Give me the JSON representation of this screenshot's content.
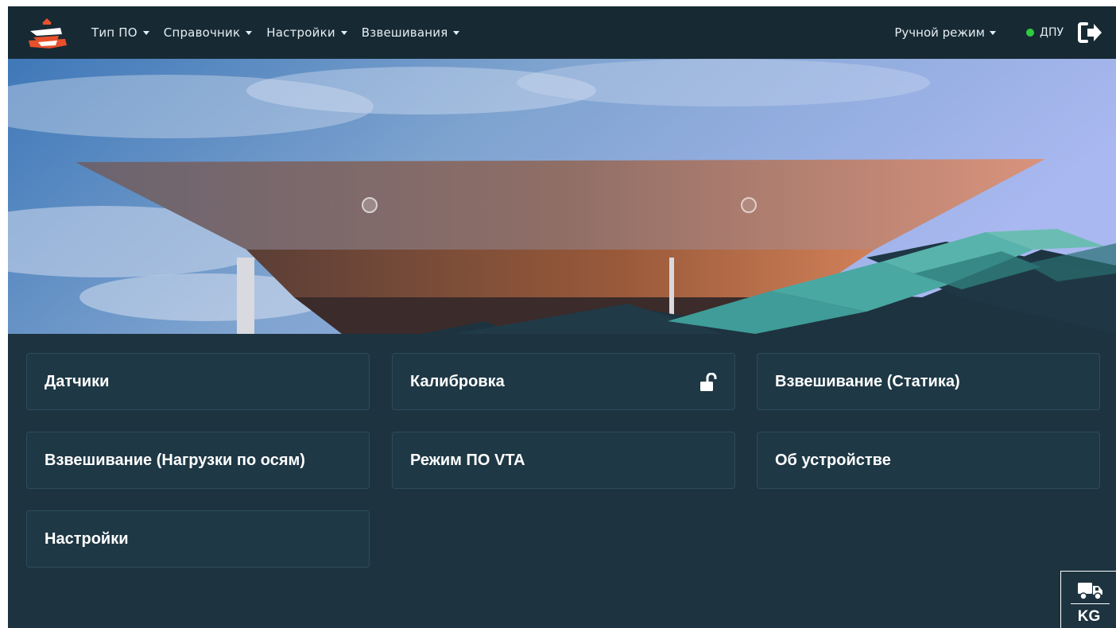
{
  "navbar": {
    "menu": [
      {
        "label": "Тип ПО"
      },
      {
        "label": "Справочник"
      },
      {
        "label": "Настройки"
      },
      {
        "label": "Взвешивания"
      }
    ],
    "mode_label": "Ручной режим",
    "status_label": "ДПУ",
    "status_color": "#2ecc40"
  },
  "cards": [
    {
      "label": "Датчики"
    },
    {
      "label": "Калибровка",
      "icon": "unlock-icon"
    },
    {
      "label": "Взвешивание (Статика)"
    },
    {
      "label": "Взвешивание (Нагрузки по осям)"
    },
    {
      "label": "Режим ПО VTA"
    },
    {
      "label": "Об устройстве"
    },
    {
      "label": "Настройки"
    }
  ],
  "unit_badge": {
    "icon": "truck-icon",
    "unit": "KG"
  },
  "colors": {
    "background": "#1d3340",
    "navbar": "#172a34",
    "card": "#1e3845",
    "accent_teal": "#3f9c98"
  }
}
